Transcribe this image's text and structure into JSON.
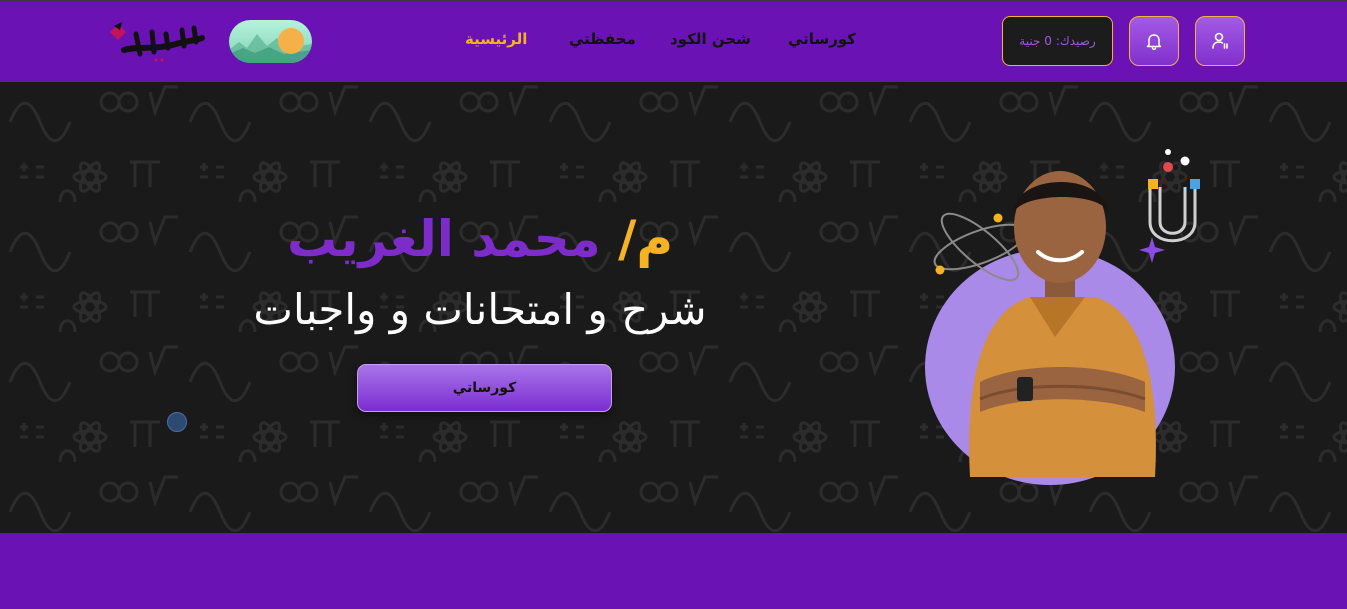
{
  "nav": {
    "links": [
      {
        "label": "الرئيسية",
        "active": true
      },
      {
        "label": "محفظتي",
        "active": false
      },
      {
        "label": "شحن الكود",
        "active": false
      },
      {
        "label": "كورساتي",
        "active": false
      }
    ],
    "balance_label": "رصيدك:",
    "balance_value": "0 جنية",
    "logo_text": "الغريب"
  },
  "hero": {
    "title_prefix": "م/",
    "title_name": "محمد الغريب",
    "subtitle": "شرح و امتحانات و واجبات",
    "cta_label": "كورساتي"
  },
  "colors": {
    "brand_purple": "#6a12b3",
    "accent_gold": "#f5b324",
    "hero_bg": "#1a1a1a",
    "name_purple": "#7d2cc9"
  },
  "icons": [
    "user-icon",
    "bell-icon",
    "theme-toggle-icon",
    "atom-icon",
    "magnet-icon"
  ]
}
